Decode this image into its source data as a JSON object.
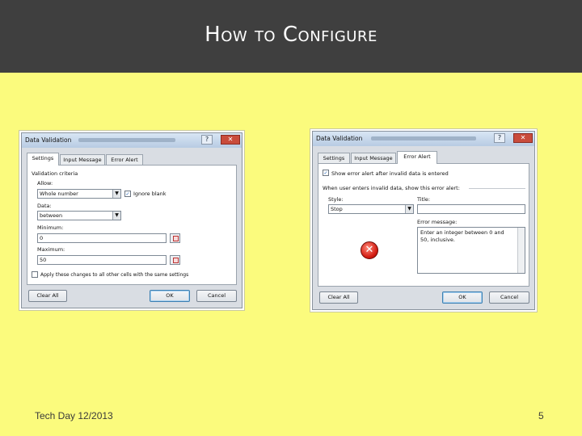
{
  "slide": {
    "title": "How to Configure",
    "footer_left": "Tech Day 12/2013",
    "page_number": "5"
  },
  "dialog_left": {
    "title": "Data Validation",
    "tabs": [
      "Settings",
      "Input Message",
      "Error Alert"
    ],
    "active_tab": "Settings",
    "section_label": "Validation criteria",
    "allow_label": "Allow:",
    "allow_value": "Whole number",
    "ignore_blank_label": "Ignore blank",
    "ignore_blank_checked": true,
    "data_label": "Data:",
    "data_value": "between",
    "minimum_label": "Minimum:",
    "minimum_value": "0",
    "maximum_label": "Maximum:",
    "maximum_value": "50",
    "apply_label": "Apply these changes to all other cells with the same settings",
    "apply_checked": false,
    "clear_all_label": "Clear All",
    "ok_label": "OK",
    "cancel_label": "Cancel",
    "help_glyph": "?",
    "close_glyph": "✕"
  },
  "dialog_right": {
    "title": "Data Validation",
    "tabs": [
      "Settings",
      "Input Message",
      "Error Alert"
    ],
    "active_tab": "Error Alert",
    "show_error_label": "Show error alert after invalid data is entered",
    "show_error_checked": true,
    "when_label": "When user enters invalid data, show this error alert:",
    "style_label": "Style:",
    "style_value": "Stop",
    "title_label": "Title:",
    "title_value": "",
    "error_message_label": "Error message:",
    "error_message_value": "Enter an integer between 0 and 50, inclusive.",
    "clear_all_label": "Clear All",
    "ok_label": "OK",
    "cancel_label": "Cancel",
    "help_glyph": "?",
    "close_glyph": "✕",
    "stop_icon": "error-stop-icon",
    "stop_glyph": "✕"
  },
  "colors": {
    "slide_background": "#fbfb7d",
    "title_bar": "#3f3f3f",
    "title_text": "#ffffff"
  }
}
